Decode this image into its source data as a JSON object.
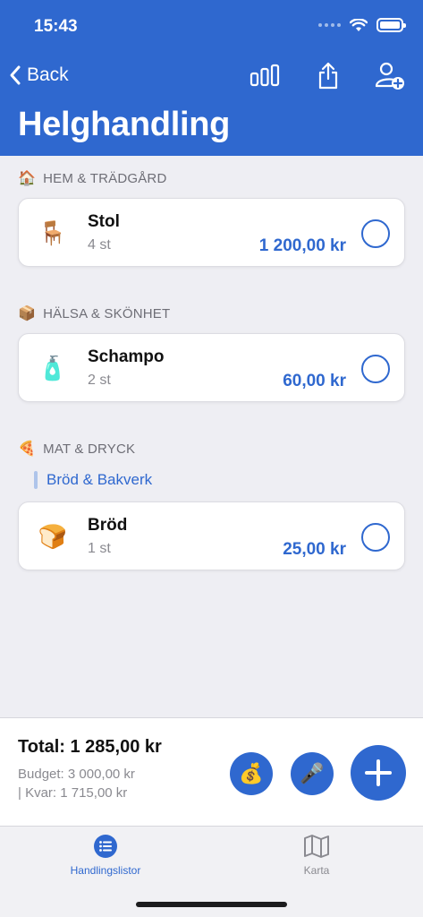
{
  "status_bar": {
    "time": "15:43"
  },
  "nav": {
    "back_label": "Back",
    "title": "Helghandling"
  },
  "sections": [
    {
      "emoji": "🏠",
      "title": "HEM & TRÄDGÅRD",
      "items": [
        {
          "emoji": "🪑",
          "name": "Stol",
          "qty": "4 st",
          "price": "1 200,00 kr"
        }
      ]
    },
    {
      "emoji": "📦",
      "title": "HÄLSA & SKÖNHET",
      "items": [
        {
          "emoji": "🧴",
          "name": "Schampo",
          "qty": "2 st",
          "price": "60,00 kr"
        }
      ]
    },
    {
      "emoji": "🍕",
      "title": "MAT & DRYCK",
      "subcategory": "Bröd & Bakverk",
      "items": [
        {
          "emoji": "🍞",
          "name": "Bröd",
          "qty": "1 st",
          "price": "25,00 kr"
        }
      ]
    }
  ],
  "summary": {
    "total": "Total: 1 285,00 kr",
    "budget": "Budget: 3 000,00 kr",
    "remaining": "| Kvar: 1 715,00 kr",
    "budget_button_emoji": "💰",
    "voice_button_emoji": "🎤"
  },
  "tabs": [
    {
      "label": "Handlingslistor",
      "icon": "list-icon",
      "active": true
    },
    {
      "label": "Karta",
      "icon": "map-icon",
      "active": false
    }
  ],
  "colors": {
    "accent": "#2f68cf",
    "background": "#eeeef3",
    "inactive_tab": "#8a8a90"
  }
}
